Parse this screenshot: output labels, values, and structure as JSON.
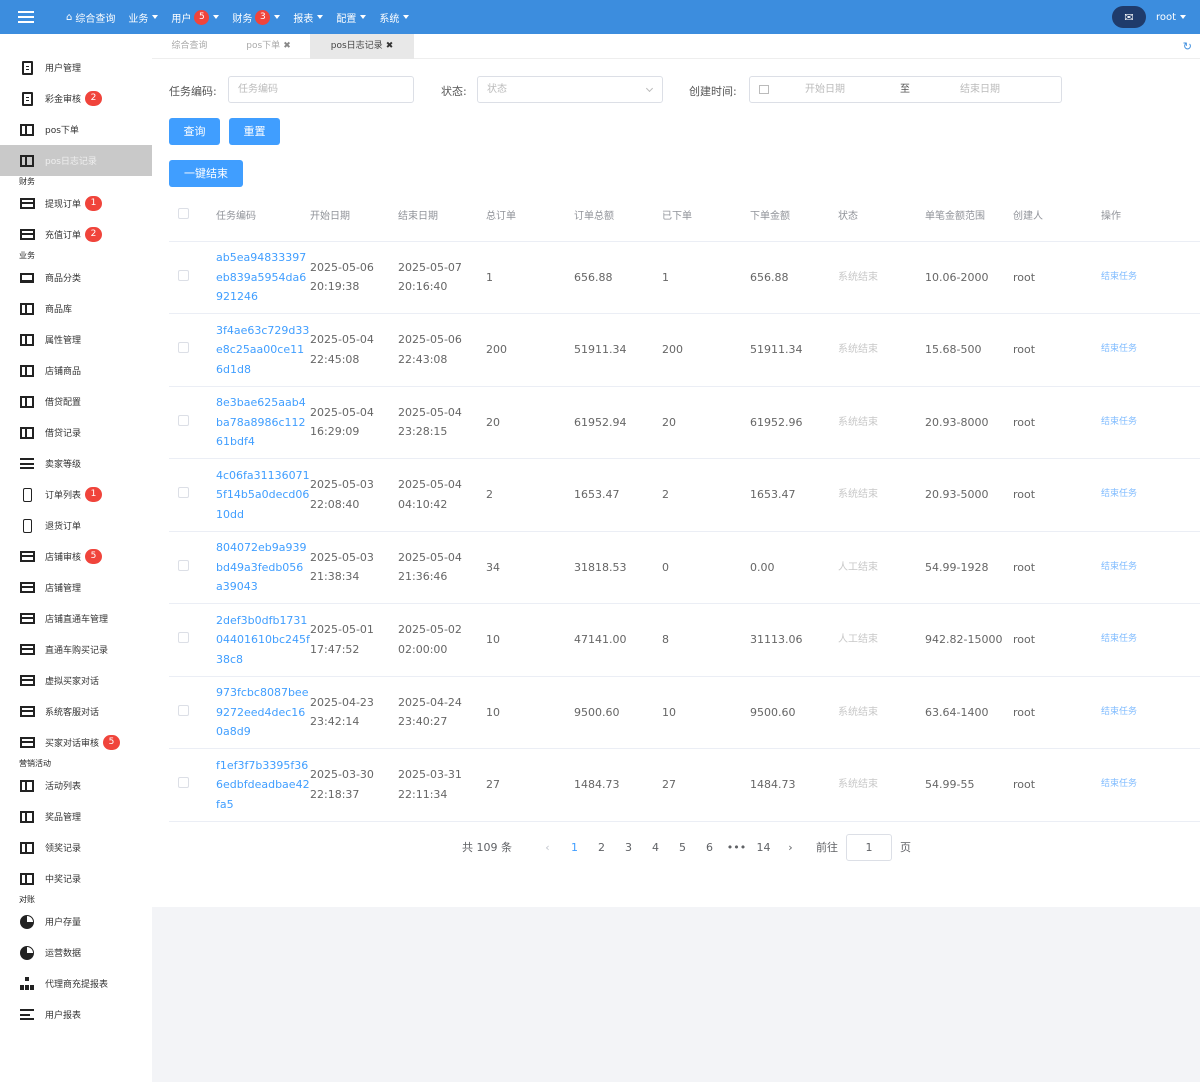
{
  "topbar": {
    "nav": [
      {
        "label": "综合查询",
        "icon": "home-icon",
        "caret": false,
        "badge": ""
      },
      {
        "label": "业务",
        "caret": true,
        "badge": ""
      },
      {
        "label": "用户",
        "caret": true,
        "badge": "5"
      },
      {
        "label": "财务",
        "caret": true,
        "badge": "3"
      },
      {
        "label": "报表",
        "caret": true,
        "badge": ""
      },
      {
        "label": "配置",
        "caret": true,
        "badge": ""
      },
      {
        "label": "系统",
        "caret": true,
        "badge": ""
      }
    ],
    "chat_icon": "chat-bubble-icon",
    "username": "root"
  },
  "sidebar": {
    "entries": [
      {
        "type": "item",
        "label": "用户管理",
        "icon": "doc"
      },
      {
        "type": "item",
        "label": "彩金审核",
        "icon": "doc",
        "badge": "2"
      },
      {
        "type": "item",
        "label": "pos下单",
        "icon": "window"
      },
      {
        "type": "item",
        "label": "pos日志记录",
        "icon": "window",
        "active": true
      },
      {
        "type": "group",
        "label": "财务"
      },
      {
        "type": "item",
        "label": "提现订单",
        "icon": "card",
        "badge": "1"
      },
      {
        "type": "item",
        "label": "充值订单",
        "icon": "card",
        "badge": "2"
      },
      {
        "type": "group",
        "label": "业务"
      },
      {
        "type": "item",
        "label": "商品分类",
        "icon": "laptop"
      },
      {
        "type": "item",
        "label": "商品库",
        "icon": "window"
      },
      {
        "type": "item",
        "label": "属性管理",
        "icon": "window"
      },
      {
        "type": "item",
        "label": "店铺商品",
        "icon": "window"
      },
      {
        "type": "item",
        "label": "借贷配置",
        "icon": "window"
      },
      {
        "type": "item",
        "label": "借贷记录",
        "icon": "window"
      },
      {
        "type": "item",
        "label": "卖家等级",
        "icon": "list"
      },
      {
        "type": "item",
        "label": "订单列表",
        "icon": "phone",
        "badge": "1"
      },
      {
        "type": "item",
        "label": "退货订单",
        "icon": "phone"
      },
      {
        "type": "item",
        "label": "店铺审核",
        "icon": "card",
        "badge": "5"
      },
      {
        "type": "item",
        "label": "店铺管理",
        "icon": "card"
      },
      {
        "type": "item",
        "label": "店铺直通车管理",
        "icon": "card"
      },
      {
        "type": "item",
        "label": "直通车购买记录",
        "icon": "card"
      },
      {
        "type": "item",
        "label": "虚拟买家对话",
        "icon": "card"
      },
      {
        "type": "item",
        "label": "系统客服对话",
        "icon": "card"
      },
      {
        "type": "item",
        "label": "买家对话审核",
        "icon": "card",
        "badge": "5"
      },
      {
        "type": "group",
        "label": "营销活动"
      },
      {
        "type": "item",
        "label": "活动列表",
        "icon": "window"
      },
      {
        "type": "item",
        "label": "奖品管理",
        "icon": "window"
      },
      {
        "type": "item",
        "label": "领奖记录",
        "icon": "window"
      },
      {
        "type": "item",
        "label": "中奖记录",
        "icon": "window"
      },
      {
        "type": "group",
        "label": "对账"
      },
      {
        "type": "item",
        "label": "用户存量",
        "icon": "pie"
      },
      {
        "type": "item",
        "label": "运营数据",
        "icon": "pie"
      },
      {
        "type": "item",
        "label": "代理商充提报表",
        "icon": "org"
      },
      {
        "type": "item",
        "label": "用户报表",
        "icon": "bars"
      }
    ]
  },
  "tabs": [
    {
      "label": "综合查询",
      "closable": false,
      "active": false
    },
    {
      "label": "pos下单",
      "closable": true,
      "active": false
    },
    {
      "label": "pos日志记录",
      "closable": true,
      "active": true
    }
  ],
  "filters": {
    "task_code_label": "任务编码:",
    "task_code_placeholder": "任务编码",
    "status_label": "状态:",
    "status_placeholder": "状态",
    "created_label": "创建时间:",
    "start_placeholder": "开始日期",
    "range_sep": "至",
    "end_placeholder": "结束日期"
  },
  "buttons": {
    "query": "查询",
    "reset": "重置",
    "end_all": "一键结束"
  },
  "table": {
    "headers": [
      "任务编码",
      "开始日期",
      "结束日期",
      "总订单",
      "订单总额",
      "已下单",
      "下单金额",
      "状态",
      "单笔金额范围",
      "创建人",
      "操作"
    ],
    "rows": [
      {
        "code": "ab5ea94833397eb839a5954da6921246",
        "start": "2025-05-06 20:19:38",
        "end": "2025-05-07 20:16:40",
        "total_orders": "1",
        "total_amount": "656.88",
        "placed": "1",
        "placed_amount": "656.88",
        "status": "系统结束",
        "range": "10.06-2000",
        "creator": "root",
        "op": "结束任务"
      },
      {
        "code": "3f4ae63c729d33e8c25aa00ce116d1d8",
        "start": "2025-05-04 22:45:08",
        "end": "2025-05-06 22:43:08",
        "total_orders": "200",
        "total_amount": "51911.34",
        "placed": "200",
        "placed_amount": "51911.34",
        "status": "系统结束",
        "range": "15.68-500",
        "creator": "root",
        "op": "结束任务"
      },
      {
        "code": "8e3bae625aab4ba78a8986c11261bdf4",
        "start": "2025-05-04 16:29:09",
        "end": "2025-05-04 23:28:15",
        "total_orders": "20",
        "total_amount": "61952.94",
        "placed": "20",
        "placed_amount": "61952.96",
        "status": "系统结束",
        "range": "20.93-8000",
        "creator": "root",
        "op": "结束任务"
      },
      {
        "code": "4c06fa311360715f14b5a0decd0610dd",
        "start": "2025-05-03 22:08:40",
        "end": "2025-05-04 04:10:42",
        "total_orders": "2",
        "total_amount": "1653.47",
        "placed": "2",
        "placed_amount": "1653.47",
        "status": "系统结束",
        "range": "20.93-5000",
        "creator": "root",
        "op": "结束任务"
      },
      {
        "code": "804072eb9a939bd49a3fedb056a39043",
        "start": "2025-05-03 21:38:34",
        "end": "2025-05-04 21:36:46",
        "total_orders": "34",
        "total_amount": "31818.53",
        "placed": "0",
        "placed_amount": "0.00",
        "status": "人工结束",
        "range": "54.99-1928",
        "creator": "root",
        "op": "结束任务"
      },
      {
        "code": "2def3b0dfb173104401610bc245f38c8",
        "start": "2025-05-01 17:47:52",
        "end": "2025-05-02 02:00:00",
        "total_orders": "10",
        "total_amount": "47141.00",
        "placed": "8",
        "placed_amount": "31113.06",
        "status": "人工结束",
        "range": "942.82-15000",
        "creator": "root",
        "op": "结束任务"
      },
      {
        "code": "973fcbc8087bee9272eed4dec160a8d9",
        "start": "2025-04-23 23:42:14",
        "end": "2025-04-24 23:40:27",
        "total_orders": "10",
        "total_amount": "9500.60",
        "placed": "10",
        "placed_amount": "9500.60",
        "status": "系统结束",
        "range": "63.64-1400",
        "creator": "root",
        "op": "结束任务"
      },
      {
        "code": "f1ef3f7b3395f366edbfdeadbae42fa5",
        "start": "2025-03-30 22:18:37",
        "end": "2025-03-31 22:11:34",
        "total_orders": "27",
        "total_amount": "1484.73",
        "placed": "27",
        "placed_amount": "1484.73",
        "status": "系统结束",
        "range": "54.99-55",
        "creator": "root",
        "op": "结束任务"
      }
    ]
  },
  "pagination": {
    "total": "共 109 条",
    "pages": [
      "1",
      "2",
      "3",
      "4",
      "5",
      "6",
      "•••",
      "14"
    ],
    "current": "1",
    "goto_label": "前往",
    "goto_value": "1",
    "page_suffix": "页"
  }
}
